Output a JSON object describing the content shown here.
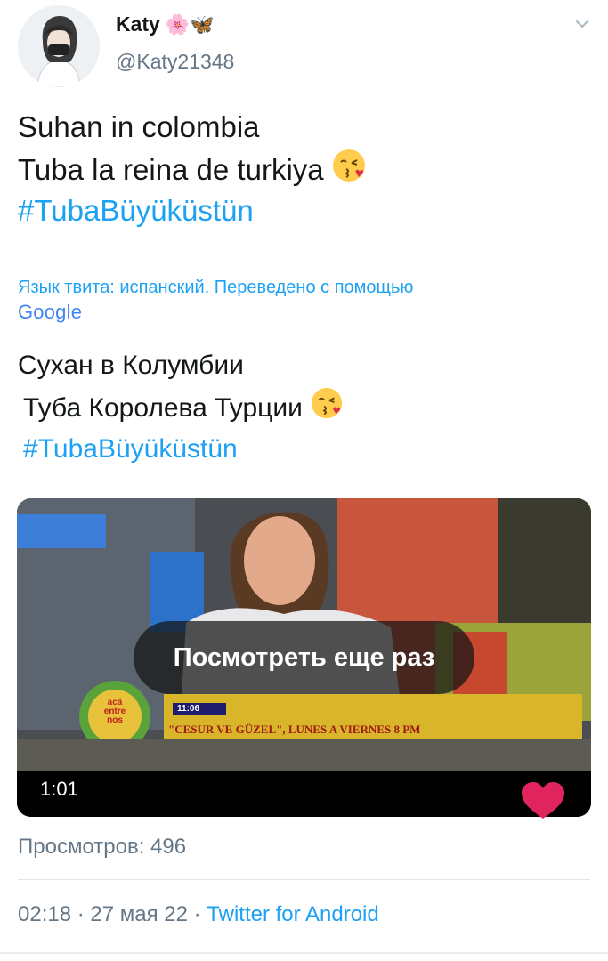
{
  "author": {
    "display_name": "Katy",
    "name_emojis": "🌸🦋",
    "handle": "@Katy21348"
  },
  "tweet": {
    "line1": "Suhan in colombia",
    "line2": "Tuba la reina de turkiya",
    "hashtag": "#TubaBüyüküstün"
  },
  "translation": {
    "note": "Язык твита: испанский. Переведено с помощью",
    "provider_logo_text": "Google",
    "line1": "Сухан в Колумбии",
    "line2": "Туба Королева Турции",
    "hashtag": "#TubaBüyüküstün"
  },
  "video": {
    "replay_label": "Посмотреть еще раз",
    "duration": "1:01",
    "overlay_logo_text": "acá entre nos",
    "overlay_time": "11:06",
    "overlay_ticker": "\"CESUR VE GÜZEL\", LUNES A VIERNES 8 PM"
  },
  "stats": {
    "views": "Просмотров: 496"
  },
  "meta": {
    "time": "02:18",
    "separator1": " · ",
    "date": "27 мая 22",
    "separator2": " · ",
    "client": "Twitter for Android"
  },
  "colors": {
    "link": "#1da1f2",
    "muted": "#657786",
    "heart": "#e0245e"
  }
}
